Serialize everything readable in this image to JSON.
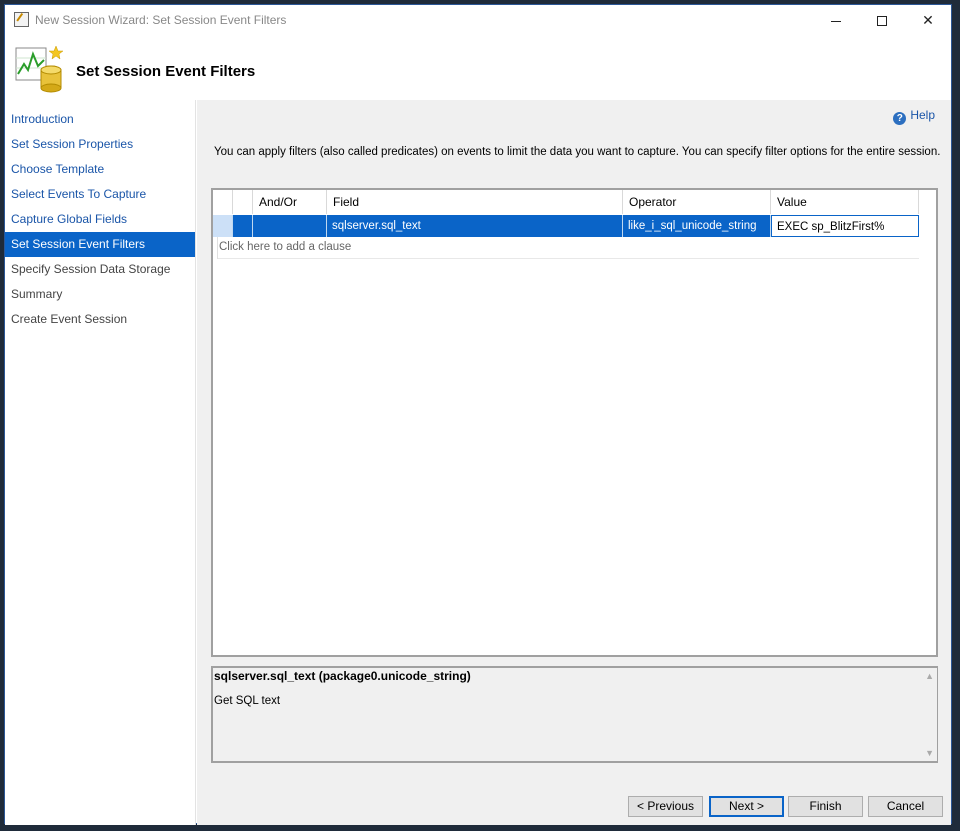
{
  "window": {
    "title": "New Session Wizard: Set Session Event Filters"
  },
  "header": {
    "page_title": "Set Session Event Filters"
  },
  "sidebar": {
    "items": [
      {
        "label": "Introduction",
        "state": "link"
      },
      {
        "label": "Set Session Properties",
        "state": "link"
      },
      {
        "label": "Choose Template",
        "state": "link"
      },
      {
        "label": "Select Events To Capture",
        "state": "link"
      },
      {
        "label": "Capture Global Fields",
        "state": "link"
      },
      {
        "label": "Set Session Event Filters",
        "state": "active"
      },
      {
        "label": "Specify Session Data Storage",
        "state": "disabled"
      },
      {
        "label": "Summary",
        "state": "disabled"
      },
      {
        "label": "Create Event Session",
        "state": "disabled"
      }
    ]
  },
  "main": {
    "help_label": "Help",
    "description": "You can apply filters (also called predicates) on events to limit the data you want to capture. You can specify filter options for the entire session."
  },
  "filter_grid": {
    "columns": [
      "And/Or",
      "Field",
      "Operator",
      "Value"
    ],
    "rows": [
      {
        "and_or": "",
        "field": "sqlserver.sql_text",
        "operator": "like_i_sql_unicode_string",
        "value": "EXEC sp_BlitzFirst%"
      }
    ],
    "add_clause_text": "Click here to add a clause"
  },
  "field_description": {
    "title": "sqlserver.sql_text (package0.unicode_string)",
    "body": "Get SQL text"
  },
  "footer": {
    "previous_label": "< Previous",
    "next_label": "Next >",
    "finish_label": "Finish",
    "cancel_label": "Cancel"
  },
  "colors": {
    "accent": "#0a64c8",
    "link": "#1a55a8",
    "panel_bg": "#f0f0f0"
  }
}
